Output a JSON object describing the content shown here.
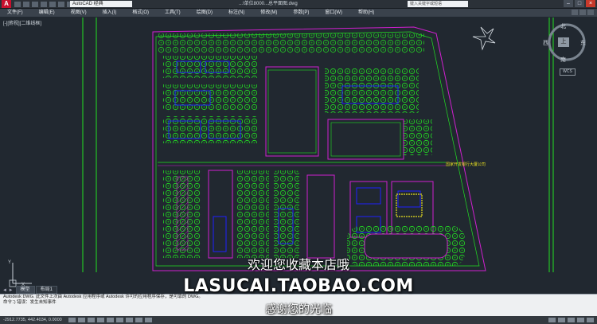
{
  "titlebar": {
    "logo_text": "A",
    "workspace": "AutoCAD 经典",
    "doc_title": "...\\单位8000...总平面图.dwg",
    "search_placeholder": "键入关键字或短语"
  },
  "menubar": {
    "items": [
      "文件(F)",
      "编辑(E)",
      "视图(V)",
      "插入(I)",
      "格式(O)",
      "工具(T)",
      "绘图(D)",
      "标注(N)",
      "修改(M)",
      "参数(P)",
      "窗口(W)",
      "帮助(H)"
    ]
  },
  "viewport": {
    "label": "[-][俯视][二维线框]",
    "drawing_note": "国家开发银行大厦公司"
  },
  "viewcube": {
    "north": "北",
    "south": "南",
    "west": "西",
    "east": "东",
    "top": "上",
    "wcs": "WCS"
  },
  "ucs": {
    "x": "X",
    "y": "Y"
  },
  "tabs": {
    "nav": "◄ ►",
    "items": [
      "模型",
      "布局1"
    ]
  },
  "command": {
    "line1": "Autodesk DWG. 此文件上次由 Autodesk 应用程序或 Autodesk 许可的应用程序保存，是可靠的 DWG。",
    "line2": "命令：) 错误：发生未知事件",
    "line3": ""
  },
  "status": {
    "coords": "-2912.7735, 442.4034, 0.0000"
  },
  "overlay": {
    "line1": "欢迎您收藏本店哦",
    "line2": "LASUCAI.TAOBAO.COM",
    "line3": "感谢您的光临"
  },
  "colors": {
    "viewport_bg": "#212830",
    "cad_green": "#22e022",
    "cad_magenta": "#d020d0",
    "cad_blue": "#2020ff",
    "cad_yellow": "#e8e020"
  }
}
